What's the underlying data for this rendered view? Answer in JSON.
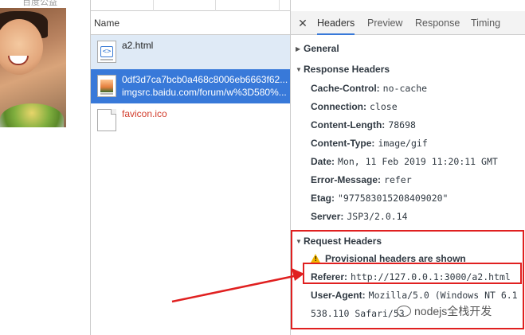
{
  "page_preview": {
    "caption": "百度公益"
  },
  "network": {
    "column_header": "Name",
    "requests": [
      {
        "name": "a2.html",
        "sub": ""
      },
      {
        "name": "0df3d7ca7bcb0a468c8006eb6663f62...",
        "sub": "imgsrc.baidu.com/forum/w%3D580%..."
      },
      {
        "name": "favicon.ico",
        "sub": ""
      }
    ]
  },
  "details": {
    "close_icon": "close-icon",
    "tabs": [
      "Headers",
      "Preview",
      "Response",
      "Timing"
    ],
    "active_tab": "Headers",
    "general_label": "General",
    "response_headers_label": "Response Headers",
    "response_headers": [
      {
        "key": "Cache-Control:",
        "value": "no-cache"
      },
      {
        "key": "Connection:",
        "value": "close"
      },
      {
        "key": "Content-Length:",
        "value": "78698"
      },
      {
        "key": "Content-Type:",
        "value": "image/gif"
      },
      {
        "key": "Date:",
        "value": "Mon, 11 Feb 2019 11:20:11 GMT"
      },
      {
        "key": "Error-Message:",
        "value": "refer"
      },
      {
        "key": "Etag:",
        "value": "\"977583015208409020\""
      },
      {
        "key": "Server:",
        "value": "JSP3/2.0.14"
      }
    ],
    "request_headers_label": "Request Headers",
    "provisional_warning": "Provisional headers are shown",
    "request_headers": [
      {
        "key": "Referer:",
        "value": "http://127.0.0.1:3000/a2.html"
      },
      {
        "key": "User-Agent:",
        "value": "Mozilla/5.0 (Windows NT 6.1"
      }
    ],
    "user_agent_cont": "538.110 Safari/53"
  },
  "watermark": "nodejs全栈开发",
  "colors": {
    "selection": "#3879d9",
    "annotation": "#e02020",
    "hover_row": "#dfeaf6"
  }
}
